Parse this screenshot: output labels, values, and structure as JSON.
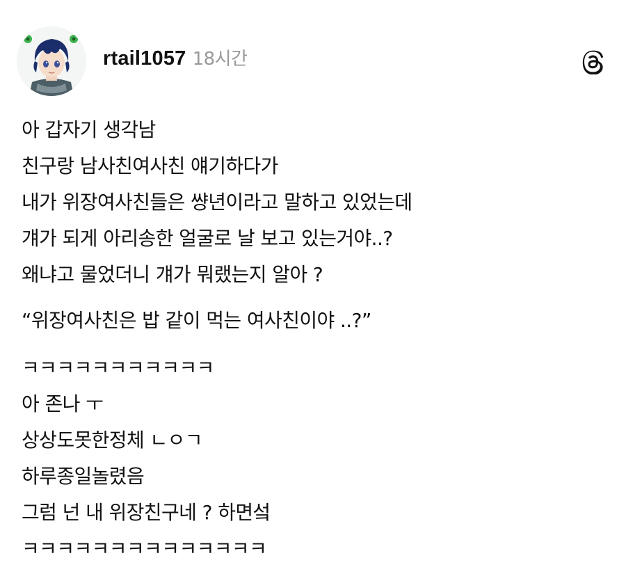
{
  "post": {
    "username": "rtail1057",
    "timestamp": "18시간",
    "avatar_icon": "avatar-anime-character",
    "app_icon": "threads-logo-icon",
    "lines_a": [
      "아 갑자기 생각남",
      "친구랑 남사친여사친 얘기하다가",
      "내가 위장여사친들은 썅년이라고 말하고 있었는데",
      "걔가 되게 아리송한 얼굴로 날 보고 있는거야..?",
      "왜냐고 물었더니 걔가 뭐랬는지 알아 ?"
    ],
    "quote": "“위장여사친은 밥 같이 먹는 여사친이야 ..?”",
    "lines_b": [
      "ㅋㅋㅋㅋㅋㅋㅋㅋㅋㅋㅋ",
      "아 존나 ㅜ",
      "상상도못한정체 ㄴㅇㄱ",
      "하루종일놀렸음",
      "그럼 넌 내 위장친구네 ? 하면섴",
      "ㅋㅋㅋㅋㅋㅋㅋㅋㅋㅋㅋㅋㅋㅋ"
    ]
  }
}
